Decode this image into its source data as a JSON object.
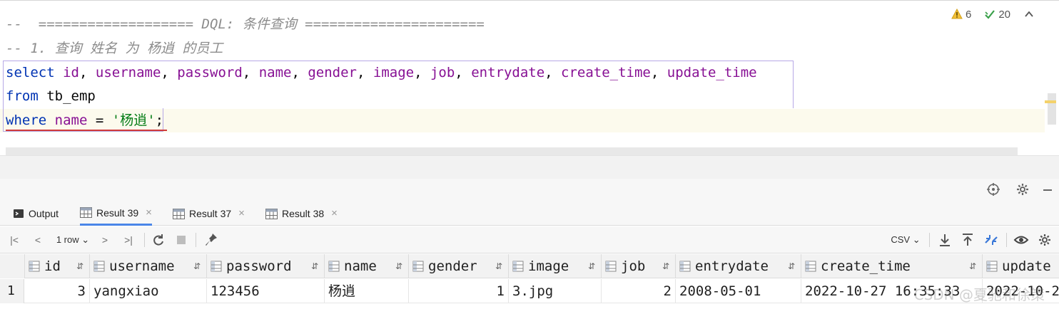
{
  "editor": {
    "lines": {
      "l1": "--  =================== DQL: 条件查询 ======================",
      "l2": "-- 1. 查询 姓名 为 杨逍 的员工",
      "select_kw": "select",
      "sp": " ",
      "comma": ", ",
      "cols": [
        "id",
        "username",
        "password",
        "name",
        "gender",
        "image",
        "job",
        "entrydate",
        "create_time",
        "update_time"
      ],
      "from_kw": "from",
      "table": "tb_emp",
      "where_kw": "where",
      "where_col": "name",
      "eq": " = ",
      "where_val": "'杨逍'",
      "semicolon": ";"
    },
    "inspections": {
      "warnings": "6",
      "ok": "20",
      "collapse": "^"
    },
    "colors": {
      "keyword": "#0033b3",
      "column": "#871094",
      "string": "#067d17",
      "comment": "#8c8c8c"
    }
  },
  "tabs": [
    {
      "label": "Output",
      "icon": "console-icon"
    },
    {
      "label": "Result 39",
      "icon": "table-icon",
      "close": "×"
    },
    {
      "label": "Result 37",
      "icon": "table-icon",
      "close": "×"
    },
    {
      "label": "Result 38",
      "icon": "table-icon",
      "close": "×"
    }
  ],
  "toolbar": {
    "first": "|<",
    "prev": "<",
    "rows": "1 row",
    "next": ">",
    "last": ">|",
    "format": "CSV"
  },
  "grid": {
    "columns": [
      "id",
      "username",
      "password",
      "name",
      "gender",
      "image",
      "job",
      "entrydate",
      "create_time",
      "update"
    ],
    "rows": [
      {
        "rownum": "1",
        "cells": [
          "3",
          "yangxiao",
          "123456",
          "杨逍",
          "1",
          "3.jpg",
          "2",
          "2008-05-01",
          "2022-10-27 16:35:33",
          "2022-10-2"
        ]
      }
    ]
  },
  "watermark": "CSDN @夏驰和徐策"
}
